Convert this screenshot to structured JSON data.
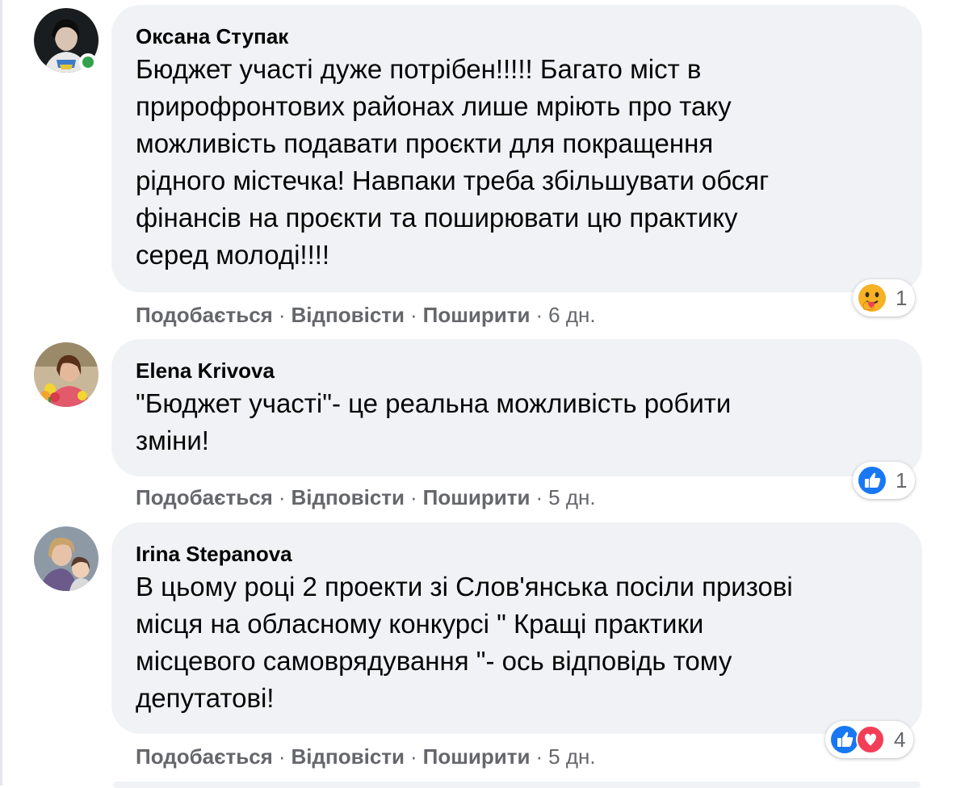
{
  "comments": [
    {
      "author": "Оксана Ступак",
      "online": true,
      "lines": [
        "Бюджет участі дуже потрібен!!!!! Багато міст в",
        "прирофронтових районах лише мріють про таку",
        "можливість подавати проєкти для покращення",
        "рідного містечка! Навпаки треба збільшувати обсяг",
        "фінансів на проєкти та поширювати цю практику",
        "серед молоді!!!!"
      ],
      "reactions": {
        "icons": [
          "care-icon"
        ],
        "count": "1"
      },
      "actions": {
        "like": "Подобається",
        "reply": "Відповісти",
        "share": "Поширити",
        "time": "6 дн."
      }
    },
    {
      "author": "Elena Krivova",
      "online": false,
      "lines": [
        "\"Бюджет участі\"- це реальна можливість робити",
        "зміни!"
      ],
      "reactions": {
        "icons": [
          "like-icon"
        ],
        "count": "1"
      },
      "actions": {
        "like": "Подобається",
        "reply": "Відповісти",
        "share": "Поширити",
        "time": "5 дн."
      }
    },
    {
      "author": "Irina Stepanova",
      "online": false,
      "lines": [
        "В цьому році 2 проекти зі Слов'янська посіли призові",
        "місця на обласному конкурсі \" Кращі практики",
        "місцевого самоврядування \"- ось відповідь тому",
        "депутатові!"
      ],
      "reactions": {
        "icons": [
          "like-icon",
          "love-icon"
        ],
        "count": "4"
      },
      "actions": {
        "like": "Подобається",
        "reply": "Відповісти",
        "share": "Поширити",
        "time": "5 дн."
      }
    }
  ],
  "separator": "·",
  "colors": {
    "bubble": "#f0f2f5",
    "meta_text": "#65676b",
    "online": "#31a24c",
    "like_blue": "#1877f2",
    "love_red": "#f33e58",
    "care_yellow": "#f7b125"
  }
}
